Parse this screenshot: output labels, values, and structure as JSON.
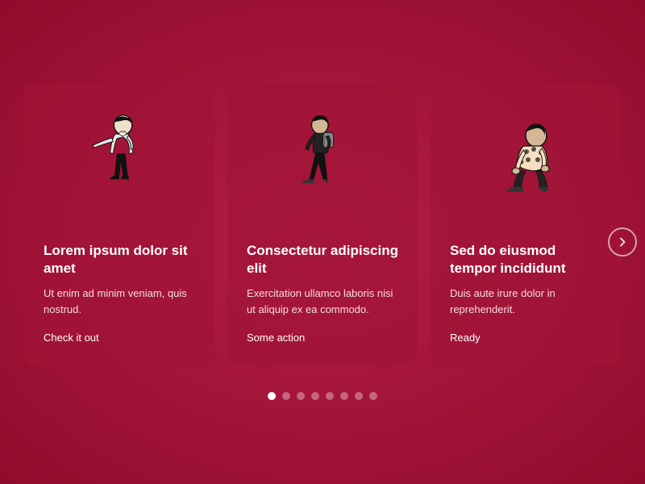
{
  "cards": [
    {
      "id": "card-1",
      "title": "Lorem ipsum dolor sit amet",
      "body": "Ut enim ad minim veniam, quis nostrud.",
      "link": "Check it out",
      "figure": "figure1"
    },
    {
      "id": "card-2",
      "title": "Consectetur adipiscing elit",
      "body": "Exercitation ullamco laboris nisi ut aliquip ex ea commodo.",
      "link": "Some action",
      "figure": "figure2"
    },
    {
      "id": "card-3",
      "title": "Sed do eiusmod tempor incididunt",
      "body": "Duis aute irure dolor in reprehenderit.",
      "link": "Ready",
      "figure": "figure3"
    }
  ],
  "dots": {
    "total": 8,
    "active": 0
  },
  "arrow": {
    "label": "→"
  }
}
